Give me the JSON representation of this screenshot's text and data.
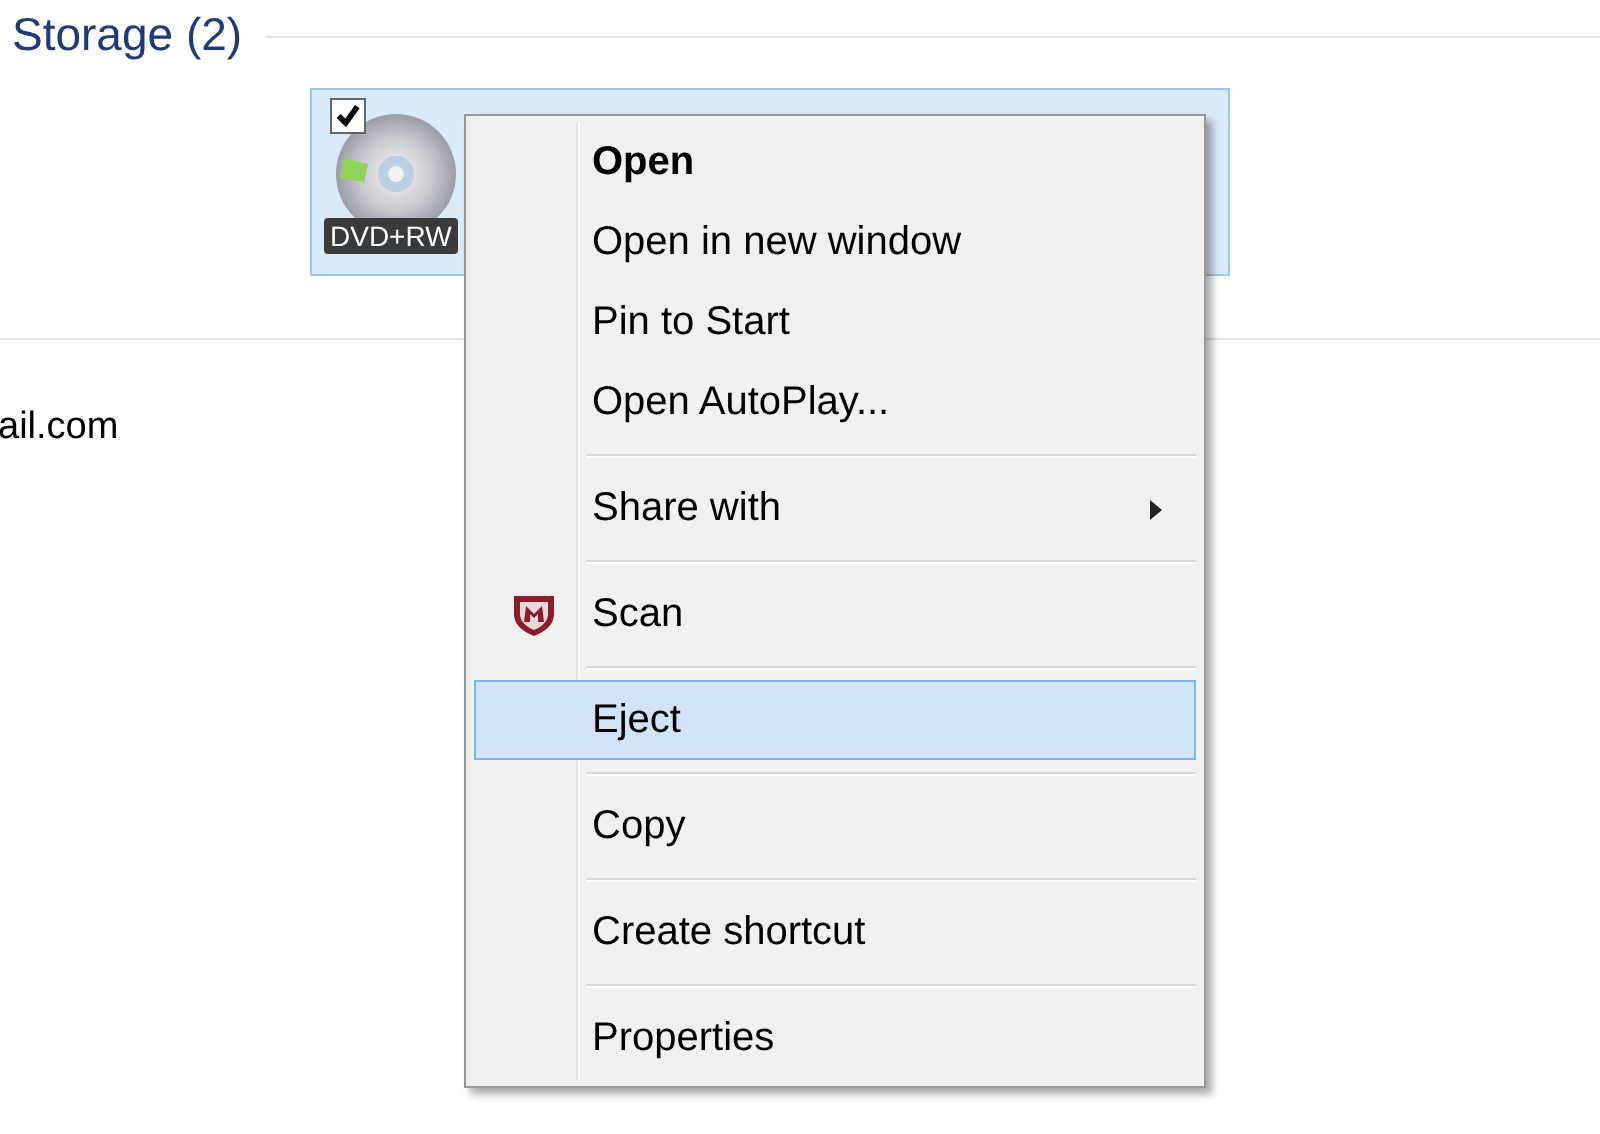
{
  "group": {
    "title": "Storage (2)"
  },
  "drive": {
    "checked": true,
    "selected": true,
    "badge": "DVD+RW"
  },
  "detail_text": "ail.com",
  "context_menu": [
    {
      "kind": "item",
      "label": "Open",
      "default": true,
      "submenu": false,
      "icon": false,
      "selected": false
    },
    {
      "kind": "item",
      "label": "Open in new window",
      "default": false,
      "submenu": false,
      "icon": false,
      "selected": false
    },
    {
      "kind": "item",
      "label": "Pin to Start",
      "default": false,
      "submenu": false,
      "icon": false,
      "selected": false
    },
    {
      "kind": "item",
      "label": "Open AutoPlay...",
      "default": false,
      "submenu": false,
      "icon": false,
      "selected": false
    },
    {
      "kind": "separator"
    },
    {
      "kind": "item",
      "label": "Share with",
      "default": false,
      "submenu": true,
      "icon": false,
      "selected": false
    },
    {
      "kind": "separator"
    },
    {
      "kind": "item",
      "label": "Scan",
      "default": false,
      "submenu": false,
      "icon": true,
      "selected": false
    },
    {
      "kind": "separator"
    },
    {
      "kind": "item",
      "label": "Eject",
      "default": false,
      "submenu": false,
      "icon": false,
      "selected": true
    },
    {
      "kind": "separator"
    },
    {
      "kind": "item",
      "label": "Copy",
      "default": false,
      "submenu": false,
      "icon": false,
      "selected": false
    },
    {
      "kind": "separator"
    },
    {
      "kind": "item",
      "label": "Create shortcut",
      "default": false,
      "submenu": false,
      "icon": false,
      "selected": false
    },
    {
      "kind": "separator"
    },
    {
      "kind": "item",
      "label": "Properties",
      "default": false,
      "submenu": false,
      "icon": false,
      "selected": false
    }
  ]
}
